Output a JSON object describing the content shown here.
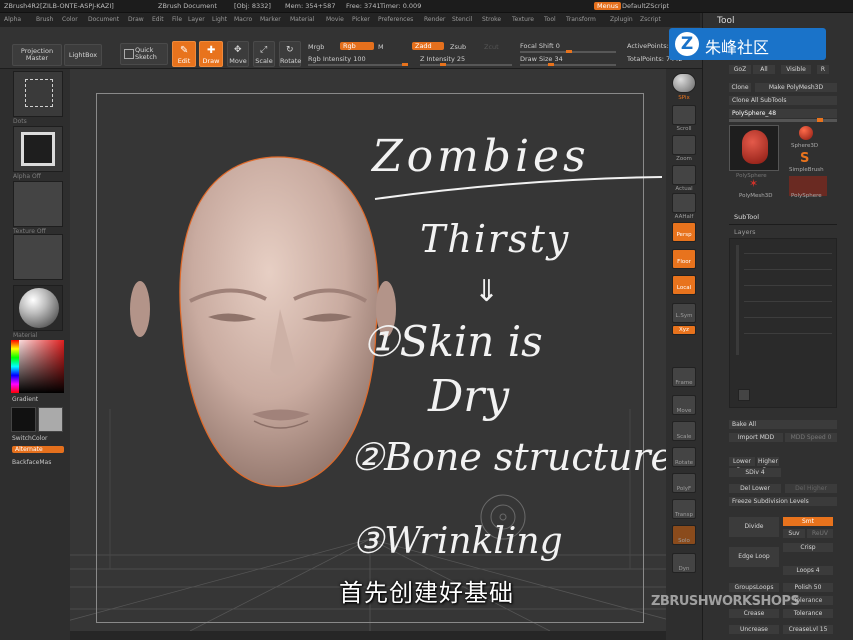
{
  "titlebar": {
    "app": "ZBrush4R2",
    "build": "[ZILB-ONTE-ASPJ-KAZI]",
    "doc": "ZBrush Document",
    "obj": "[Obj: 8332]",
    "mem": "Mem: 354+587",
    "free": "Free: 3741",
    "timer": "Timer: 0.009",
    "menus_chip": "Menus",
    "script": "DefaultZScript",
    "tool_title": "Tool"
  },
  "menubar": [
    "Alpha",
    "Brush",
    "Color",
    "Document",
    "Draw",
    "Edit",
    "File",
    "Layer",
    "Light",
    "Macro",
    "Marker",
    "Material",
    "Movie",
    "Picker",
    "Preferences",
    "Render",
    "Stencil",
    "Stroke",
    "Texture",
    "Tool",
    "Transform",
    "Zplugin",
    "Zscript"
  ],
  "shelf": {
    "projection_master": "Projection Master",
    "lightbox": "LightBox",
    "quick_sketch": "Quick Sketch",
    "edit": "Edit",
    "draw": "Draw",
    "move": "Move",
    "scale": "Scale",
    "rotate": "Rotate",
    "mrgb": "Mrgb",
    "rgb": "Rgb",
    "m": "M",
    "rgb_intensity": "Rgb Intensity 100",
    "zadd": "Zadd",
    "zsub": "Zsub",
    "zcut": "Zcut",
    "z_intensity": "Z Intensity 25",
    "focal_shift": "Focal Shift 0",
    "draw_size": "Draw Size 34",
    "active_points": "ActivePoints:",
    "total_points": "TotalPoints: 7442"
  },
  "leftpanel": {
    "tiles": [
      "Dots",
      "Alpha Off",
      "Texture Off",
      "Material"
    ],
    "gradient": "Gradient",
    "switchcolor": "SwitchColor",
    "alternate": "Alternate",
    "backfacemask": "BackfaceMas"
  },
  "rstrip": [
    "SPix",
    "Scroll",
    "Zoom",
    "Actual",
    "AAHalf",
    "Persp",
    "Floor",
    "Local",
    "L.Sym",
    "Xyz",
    "Frame",
    "Move",
    "Scale",
    "Rotate",
    "PolyF",
    "Transp",
    "Solo",
    "Dyn"
  ],
  "toolpanel": {
    "goz": "GoZ",
    "all": "All",
    "visible": "Visible",
    "r": "R",
    "clone": "Clone",
    "make_polymesh": "Make PolyMesh3D",
    "clone_subtools": "Clone All SubTools",
    "current_tool": "PolySphere_48",
    "count": "48",
    "thumbs": [
      "PolySphere",
      "Sphere3D",
      "SimpleBrush",
      "PolyMesh3D",
      "PolySphere"
    ],
    "subtool": "SubTool",
    "layers": "Layers",
    "bake_all": "Bake All",
    "import_mdd": "Import MDD",
    "mdd_speed": "MDD Speed 0",
    "sdiv": "SDiv 4",
    "del_lower": "Del Lower",
    "del_higher": "Del Higher",
    "freeze": "Freeze Subdivision Levels",
    "divide": "Divide",
    "smt": "Smt",
    "suv": "Suv",
    "redu": "ReUV",
    "edge_loop": "Edge Loop",
    "crisp": "Crisp",
    "loops": "Loops 4",
    "groups_loops": "GroupsLoops",
    "polish": "Polish 50",
    "tolerance": "Tolerance",
    "crease": "Crease",
    "uncrease": "Uncrease",
    "crease_lvl": "CreaseLvl 15",
    "lower_res": "Lower Res",
    "higher_res": "Higher Res"
  },
  "annotation": {
    "title": "Zombies",
    "l1": "Thirsty",
    "arrow": "⇓",
    "l2": "①Skin is",
    "l3": "Dry",
    "l4": "②Bone structure",
    "l5": "③Wrinkling"
  },
  "watermark": {
    "mark": "Z",
    "text": "朱峰社区"
  },
  "subtitle": "首先创建好基础",
  "brand": "ZBRUSHWORKSHOPS",
  "colors": {
    "accent": "#e8731d",
    "logo_bg": "#1a73c9"
  }
}
